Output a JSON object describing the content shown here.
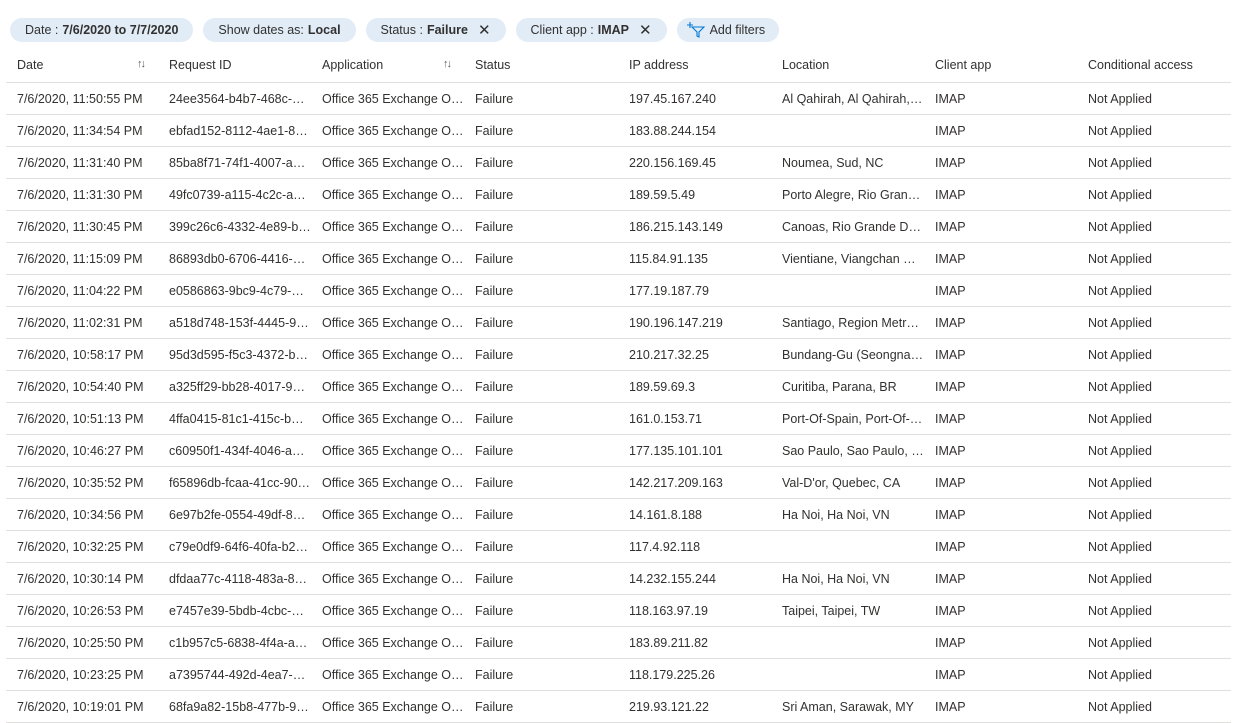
{
  "filters": {
    "date": {
      "label": "Date :",
      "value": "7/6/2020 to 7/7/2020"
    },
    "show_dates": {
      "label": "Show dates as:",
      "value": "Local"
    },
    "status": {
      "label": "Status :",
      "value": "Failure"
    },
    "client_app": {
      "label": "Client app :",
      "value": "IMAP"
    },
    "add_filters": "Add filters"
  },
  "columns": [
    "Date",
    "Request ID",
    "Application",
    "Status",
    "IP address",
    "Location",
    "Client app",
    "Conditional access"
  ],
  "rows": [
    [
      "7/6/2020, 11:50:55 PM",
      "24ee3564-b4b7-468c-…",
      "Office 365 Exchange O…",
      "Failure",
      "197.45.167.240",
      "Al Qahirah, Al Qahirah,…",
      "IMAP",
      "Not Applied"
    ],
    [
      "7/6/2020, 11:34:54 PM",
      "ebfad152-8112-4ae1-8…",
      "Office 365 Exchange O…",
      "Failure",
      "183.88.244.154",
      "",
      "IMAP",
      "Not Applied"
    ],
    [
      "7/6/2020, 11:31:40 PM",
      "85ba8f71-74f1-4007-a…",
      "Office 365 Exchange O…",
      "Failure",
      "220.156.169.45",
      "Noumea, Sud, NC",
      "IMAP",
      "Not Applied"
    ],
    [
      "7/6/2020, 11:31:30 PM",
      "49fc0739-a115-4c2c-a…",
      "Office 365 Exchange O…",
      "Failure",
      "189.59.5.49",
      "Porto Alegre, Rio Gran…",
      "IMAP",
      "Not Applied"
    ],
    [
      "7/6/2020, 11:30:45 PM",
      "399c26c6-4332-4e89-b…",
      "Office 365 Exchange O…",
      "Failure",
      "186.215.143.149",
      "Canoas, Rio Grande Do…",
      "IMAP",
      "Not Applied"
    ],
    [
      "7/6/2020, 11:15:09 PM",
      "86893db0-6706-4416-…",
      "Office 365 Exchange O…",
      "Failure",
      "115.84.91.135",
      "Vientiane, Viangchan C…",
      "IMAP",
      "Not Applied"
    ],
    [
      "7/6/2020, 11:04:22 PM",
      "e0586863-9bc9-4c79-…",
      "Office 365 Exchange O…",
      "Failure",
      "177.19.187.79",
      "",
      "IMAP",
      "Not Applied"
    ],
    [
      "7/6/2020, 11:02:31 PM",
      "a518d748-153f-4445-9…",
      "Office 365 Exchange O…",
      "Failure",
      "190.196.147.219",
      "Santiago, Region Metr…",
      "IMAP",
      "Not Applied"
    ],
    [
      "7/6/2020, 10:58:17 PM",
      "95d3d595-f5c3-4372-b…",
      "Office 365 Exchange O…",
      "Failure",
      "210.217.32.25",
      "Bundang-Gu (Seongna…",
      "IMAP",
      "Not Applied"
    ],
    [
      "7/6/2020, 10:54:40 PM",
      "a325ff29-bb28-4017-9…",
      "Office 365 Exchange O…",
      "Failure",
      "189.59.69.3",
      "Curitiba, Parana, BR",
      "IMAP",
      "Not Applied"
    ],
    [
      "7/6/2020, 10:51:13 PM",
      "4ffa0415-81c1-415c-b…",
      "Office 365 Exchange O…",
      "Failure",
      "161.0.153.71",
      "Port-Of-Spain, Port-Of-…",
      "IMAP",
      "Not Applied"
    ],
    [
      "7/6/2020, 10:46:27 PM",
      "c60950f1-434f-4046-a…",
      "Office 365 Exchange O…",
      "Failure",
      "177.135.101.101",
      "Sao Paulo, Sao Paulo, BR",
      "IMAP",
      "Not Applied"
    ],
    [
      "7/6/2020, 10:35:52 PM",
      "f65896db-fcaa-41cc-90…",
      "Office 365 Exchange O…",
      "Failure",
      "142.217.209.163",
      "Val-D'or, Quebec, CA",
      "IMAP",
      "Not Applied"
    ],
    [
      "7/6/2020, 10:34:56 PM",
      "6e97b2fe-0554-49df-8…",
      "Office 365 Exchange O…",
      "Failure",
      "14.161.8.188",
      "Ha Noi, Ha Noi, VN",
      "IMAP",
      "Not Applied"
    ],
    [
      "7/6/2020, 10:32:25 PM",
      "c79e0df9-64f6-40fa-b2…",
      "Office 365 Exchange O…",
      "Failure",
      "117.4.92.118",
      "",
      "IMAP",
      "Not Applied"
    ],
    [
      "7/6/2020, 10:30:14 PM",
      "dfdaa77c-4118-483a-8…",
      "Office 365 Exchange O…",
      "Failure",
      "14.232.155.244",
      "Ha Noi, Ha Noi, VN",
      "IMAP",
      "Not Applied"
    ],
    [
      "7/6/2020, 10:26:53 PM",
      "e7457e39-5bdb-4cbc-…",
      "Office 365 Exchange O…",
      "Failure",
      "118.163.97.19",
      "Taipei, Taipei, TW",
      "IMAP",
      "Not Applied"
    ],
    [
      "7/6/2020, 10:25:50 PM",
      "c1b957c5-6838-4f4a-a…",
      "Office 365 Exchange O…",
      "Failure",
      "183.89.211.82",
      "",
      "IMAP",
      "Not Applied"
    ],
    [
      "7/6/2020, 10:23:25 PM",
      "a7395744-492d-4ea7-…",
      "Office 365 Exchange O…",
      "Failure",
      "118.179.225.26",
      "",
      "IMAP",
      "Not Applied"
    ],
    [
      "7/6/2020, 10:19:01 PM",
      "68fa9a82-15b8-477b-9…",
      "Office 365 Exchange O…",
      "Failure",
      "219.93.121.22",
      "Sri Aman, Sarawak, MY",
      "IMAP",
      "Not Applied"
    ]
  ],
  "icons": {
    "sort": "sort-arrows-icon",
    "remove": "close-icon",
    "add_filter": "add-filter-icon"
  },
  "colors": {
    "pill_bg": "#e1ecf7",
    "divider": "#e1dfdd",
    "text": "#323130"
  }
}
